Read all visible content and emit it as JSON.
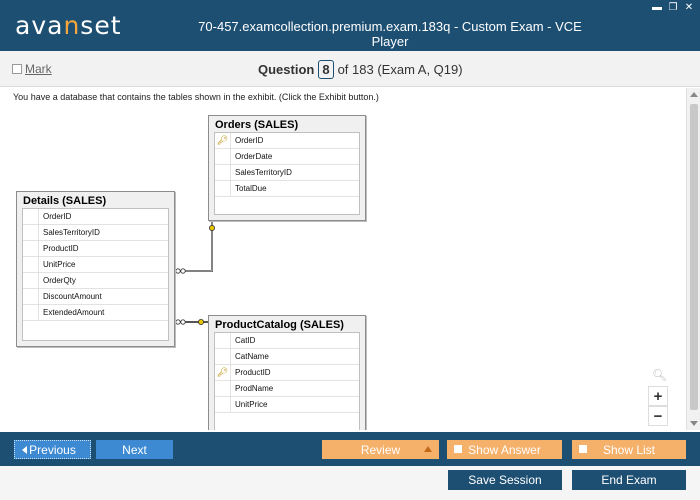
{
  "window": {
    "logo_prefix": "ava",
    "logo_accent": "n",
    "logo_suffix": "set",
    "title": "70-457.examcollection.premium.exam.183q - Custom Exam - VCE Player"
  },
  "header": {
    "mark_label": "Mark",
    "question_label": "Question",
    "question_number": "8",
    "question_total": "of 183 (Exam A, Q19)"
  },
  "question": {
    "text": "You have a database that contains the tables shown in the exhibit. (Click the Exhibit button.)"
  },
  "exhibit": {
    "orders": {
      "name": "Orders (SALES)",
      "columns": [
        "OrderID",
        "OrderDate",
        "SalesTerritoryID",
        "TotalDue"
      ]
    },
    "details": {
      "name": "Details (SALES)",
      "columns": [
        "OrderID",
        "SalesTerritoryID",
        "ProductID",
        "UnitPrice",
        "OrderQty",
        "DiscountAmount",
        "ExtendedAmount"
      ]
    },
    "catalog": {
      "name": "ProductCatalog (SALES)",
      "columns": [
        "CatID",
        "CatName",
        "ProductID",
        "ProdName",
        "UnitPrice"
      ]
    }
  },
  "zoom": {
    "in": "+",
    "out": "−"
  },
  "nav": {
    "previous": "Previous",
    "next": "Next",
    "review": "Review",
    "show_answer": "Show Answer",
    "show_list": "Show List",
    "save_session": "Save Session",
    "end_exam": "End Exam"
  },
  "colors": {
    "primary": "#1d4f73",
    "nav_blue": "#3d8ad2",
    "orange": "#f5b06a",
    "logo_accent": "#f4a63c"
  }
}
